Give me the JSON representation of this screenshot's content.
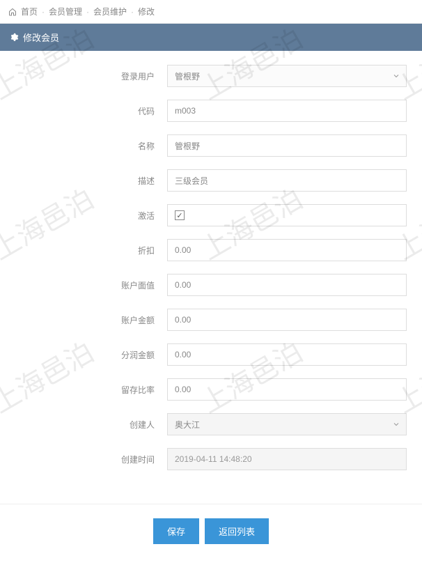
{
  "watermark": "上海邑泊",
  "breadcrumb": {
    "home": "首页",
    "level1": "会员管理",
    "level2": "会员维护",
    "current": "修改"
  },
  "panel": {
    "title": "修改会员"
  },
  "form": {
    "login_user": {
      "label": "登录用户",
      "value": "管根野"
    },
    "code": {
      "label": "代码",
      "value": "m003"
    },
    "name": {
      "label": "名称",
      "value": "管根野"
    },
    "description": {
      "label": "描述",
      "value": "三级会员"
    },
    "active": {
      "label": "激活",
      "checked": true,
      "mark": "✓"
    },
    "discount": {
      "label": "折扣",
      "value": "0.00"
    },
    "account_face_value": {
      "label": "账户面值",
      "value": "0.00"
    },
    "account_amount": {
      "label": "账户金额",
      "value": "0.00"
    },
    "commission_amount": {
      "label": "分润金额",
      "value": "0.00"
    },
    "retention_ratio": {
      "label": "留存比率",
      "value": "0.00"
    },
    "creator": {
      "label": "创建人",
      "value": "奥大江"
    },
    "created_at": {
      "label": "创建时间",
      "value": "2019-04-11 14:48:20"
    }
  },
  "buttons": {
    "save": "保存",
    "back": "返回列表"
  }
}
